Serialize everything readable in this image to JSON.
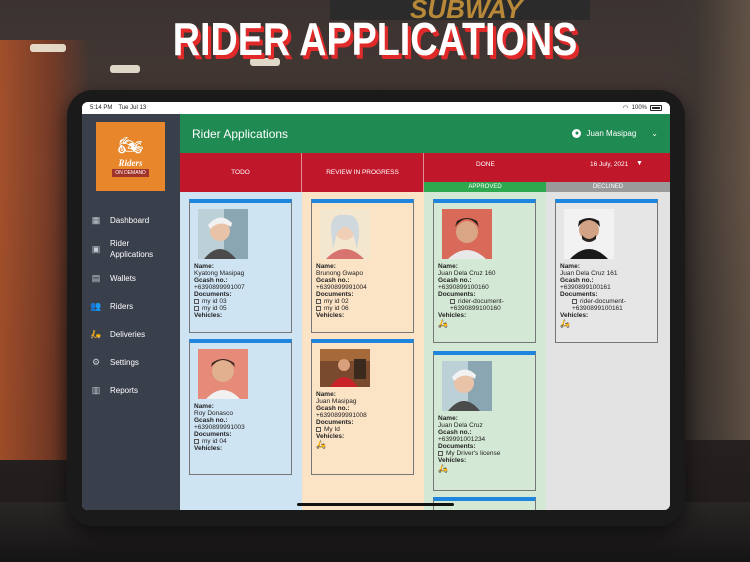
{
  "headline": "RIDER APPLICATIONS",
  "background": {
    "store_sign": "SUBWAY"
  },
  "status_bar": {
    "time": "5:14 PM",
    "date": "Tue Jul 13",
    "battery": "100%"
  },
  "sidebar": {
    "logo": {
      "brand": "Riders",
      "tag": "ON DEMAND"
    },
    "items": [
      {
        "label": "Dashboard",
        "icon": "dashboard-icon"
      },
      {
        "label": "Rider Applications",
        "icon": "id-card-icon"
      },
      {
        "label": "Wallets",
        "icon": "wallet-icon"
      },
      {
        "label": "Riders",
        "icon": "people-icon"
      },
      {
        "label": "Deliveries",
        "icon": "delivery-icon"
      },
      {
        "label": "Settings",
        "icon": "gear-icon"
      },
      {
        "label": "Reports",
        "icon": "report-icon"
      }
    ]
  },
  "topbar": {
    "title": "Rider Applications",
    "user": "Juan Masipag"
  },
  "columns": {
    "todo": "TODO",
    "review": "REVIEW IN PROGRESS",
    "done": "DONE",
    "date": "16 July, 2021",
    "approved": "APPROVED",
    "declined": "DECLINED"
  },
  "labels": {
    "name": "Name:",
    "gcash": "Gcash no.:",
    "documents": "Documents:",
    "vehicles": "Vehicles:"
  },
  "cards": {
    "todo1": {
      "name": "Kyatong Masipag",
      "gcash": "+6390899991007",
      "doc1": "my id 03",
      "doc2": "my id 05"
    },
    "todo2": {
      "name": "Roy Donasco",
      "gcash": "+6390899991003",
      "doc1": "my id 04"
    },
    "review1": {
      "name": "Brunong Gwapo",
      "gcash": "+6390899991004",
      "doc1": "my id 02",
      "doc2": "my id 06"
    },
    "review2": {
      "name": "Juan Masipag",
      "gcash": "+6390899991008",
      "doc1": "My Id"
    },
    "approved1": {
      "name": "Juan Dela Cruz 160",
      "gcash": "+6390899100160",
      "doc1": "rider-document-",
      "doc1b": "+6390899100160"
    },
    "approved2": {
      "name": "Juan Dela Cruz",
      "gcash": "+639991001234",
      "doc1": "My Driver's license"
    },
    "declined1": {
      "name": "Juan Dela Cruz 161",
      "gcash": "+6390899100161",
      "doc1": "rider-document-",
      "doc1b": "+6390899100161"
    }
  }
}
